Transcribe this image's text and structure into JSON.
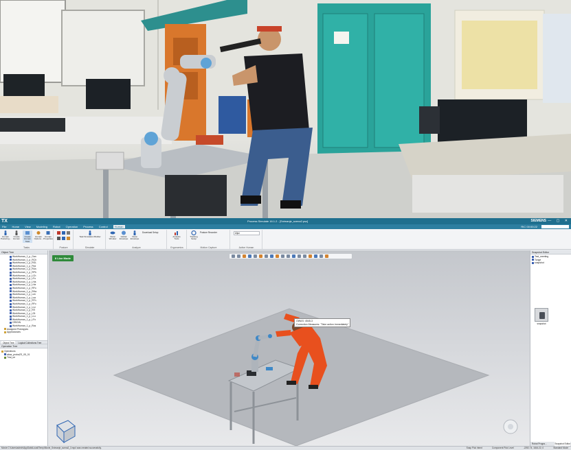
{
  "app": {
    "logo": "TX",
    "window_title": "Process Simulate 16.1.2 - [Snimanje_scena2.psz]",
    "brand": "SIEMENS",
    "window_buttons": "— ▢ ✕"
  },
  "menu": {
    "items": [
      "File",
      "Home",
      "View",
      "Modeling",
      "Robot",
      "Operation",
      "Process",
      "Control",
      "Human"
    ],
    "active": "Human",
    "right_timer": "RIC 00:00:22",
    "right_search_placeholder": "Search"
  },
  "ribbon": {
    "groups": [
      {
        "label": "Tasks",
        "buttons": [
          "Human Posturing...",
          "Create Human",
          "Create Human Task",
          "Human Options...",
          "Human Properties"
        ]
      },
      {
        "label": "Posture",
        "buttons": []
      },
      {
        "label": "Simulate",
        "buttons": [
          "Task Simulation Builder"
        ]
      },
      {
        "label": "Analyze",
        "buttons": [
          "Vision Window",
          "Global Envelope",
          "Vision Envelope"
        ]
      },
      {
        "label": "Ergonomics",
        "buttons": [
          "Analysis Tools",
          "Tracking Setup"
        ]
      },
      {
        "label": "Motion Capture",
        "buttons": [
          "Posture Recorder"
        ]
      },
      {
        "label": "Active Human",
        "buttons": []
      }
    ],
    "small_items": [
      "Download Setup",
      "Tracking Setup",
      "Posture Recorder"
    ],
    "active_human_value": "Aljaz"
  },
  "object_tree": {
    "header": "Object Tree",
    "items": [
      "WorkHuman_1_p_Gan",
      "WorkHuman_1_p_RCh",
      "WorkHuman_1_p_RGL",
      "WorkHuman_1_p_Ped",
      "WorkHuman_1_p_RUs",
      "WorkHuman_1_p_RPh",
      "WorkHuman_1_p_LCh",
      "WorkHuman_1_p_LFo",
      "WorkHuman_1_p_LHa",
      "WorkHuman_1_p_LHe",
      "WorkHuman_1_p_RFo",
      "WorkHuman_1_p_RHa",
      "WorkHuman_1_p_Lsh",
      "WorkHuman_1_p_Lua",
      "WorkHuman_1_p_RTh",
      "WorkHuman_1_p_RFo",
      "WorkHuman_1_p_LLe",
      "WorkHuman_1_p_RTi",
      "WorkHuman_1_p_LSt",
      "WorkHuman_1_p_LLo",
      "WorkHuman_1_p_LFo",
      "ORIGIN",
      "WorkHuman_1_p_Rus",
      "Assigned Prototypes",
      "Appearances"
    ],
    "tabs": [
      "Object Tree",
      "Logical Collections Tree"
    ]
  },
  "operation_tree": {
    "header": "Operation Tree",
    "items": [
      "Operations",
      "abaz_probaZS_05_01",
      "Trial_ue"
    ]
  },
  "viewport": {
    "live_mode": "II Live Mode",
    "tooltip_line1": "OWAS:  4545-3",
    "tooltip_line2": "Correction Measures: \"Take action immediately\""
  },
  "snapshot_editor": {
    "header": "Snapshot Editor",
    "items": [
      "Test_meeting",
      "Tonge",
      "snapshot"
    ],
    "thumb_caption": "snapshot",
    "tabs": [
      "Robot Progra...",
      "Snapshot Editor"
    ]
  },
  "status": {
    "message": "Movie C:\\Users\\admin\\AppData\\Local\\Temp\\Movie_Snimanje_scena2_3.mp4 was created successfully.",
    "snap": "Snap Pick Intent",
    "component": "Component Pick Level",
    "coords": "-2292.74, 1816.22, 0",
    "mode": "Standard Mode"
  },
  "colors": {
    "title_bar": "#1f6f8e",
    "menu_bar": "#2c7ea0",
    "live_mode": "#2f8a3a",
    "human_suit": "#e8501e"
  }
}
